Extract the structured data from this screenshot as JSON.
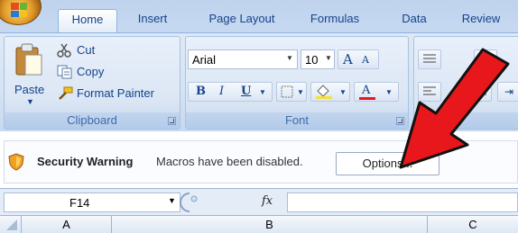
{
  "tabs": [
    "Home",
    "Insert",
    "Page Layout",
    "Formulas",
    "Data",
    "Review"
  ],
  "clipboard": {
    "paste_label": "Paste",
    "cut_label": "Cut",
    "copy_label": "Copy",
    "format_painter_label": "Format Painter",
    "group_label": "Clipboard"
  },
  "font": {
    "font_name": "Arial",
    "font_size": "10",
    "bold": "B",
    "italic": "I",
    "underline": "U",
    "grow_font": "A",
    "shrink_font": "A",
    "font_color": "A",
    "group_label": "Font"
  },
  "security": {
    "title": "Security Warning",
    "message": "Macros have been disabled.",
    "options_label": "Options..."
  },
  "formula_bar": {
    "name_box": "F14",
    "fx_label": "fx",
    "value": ""
  },
  "columns": [
    "A",
    "B",
    "C"
  ],
  "colors": {
    "arrow": "#e8171b",
    "ribbon_text": "#15428b",
    "group_label": "#3e6aaa"
  }
}
